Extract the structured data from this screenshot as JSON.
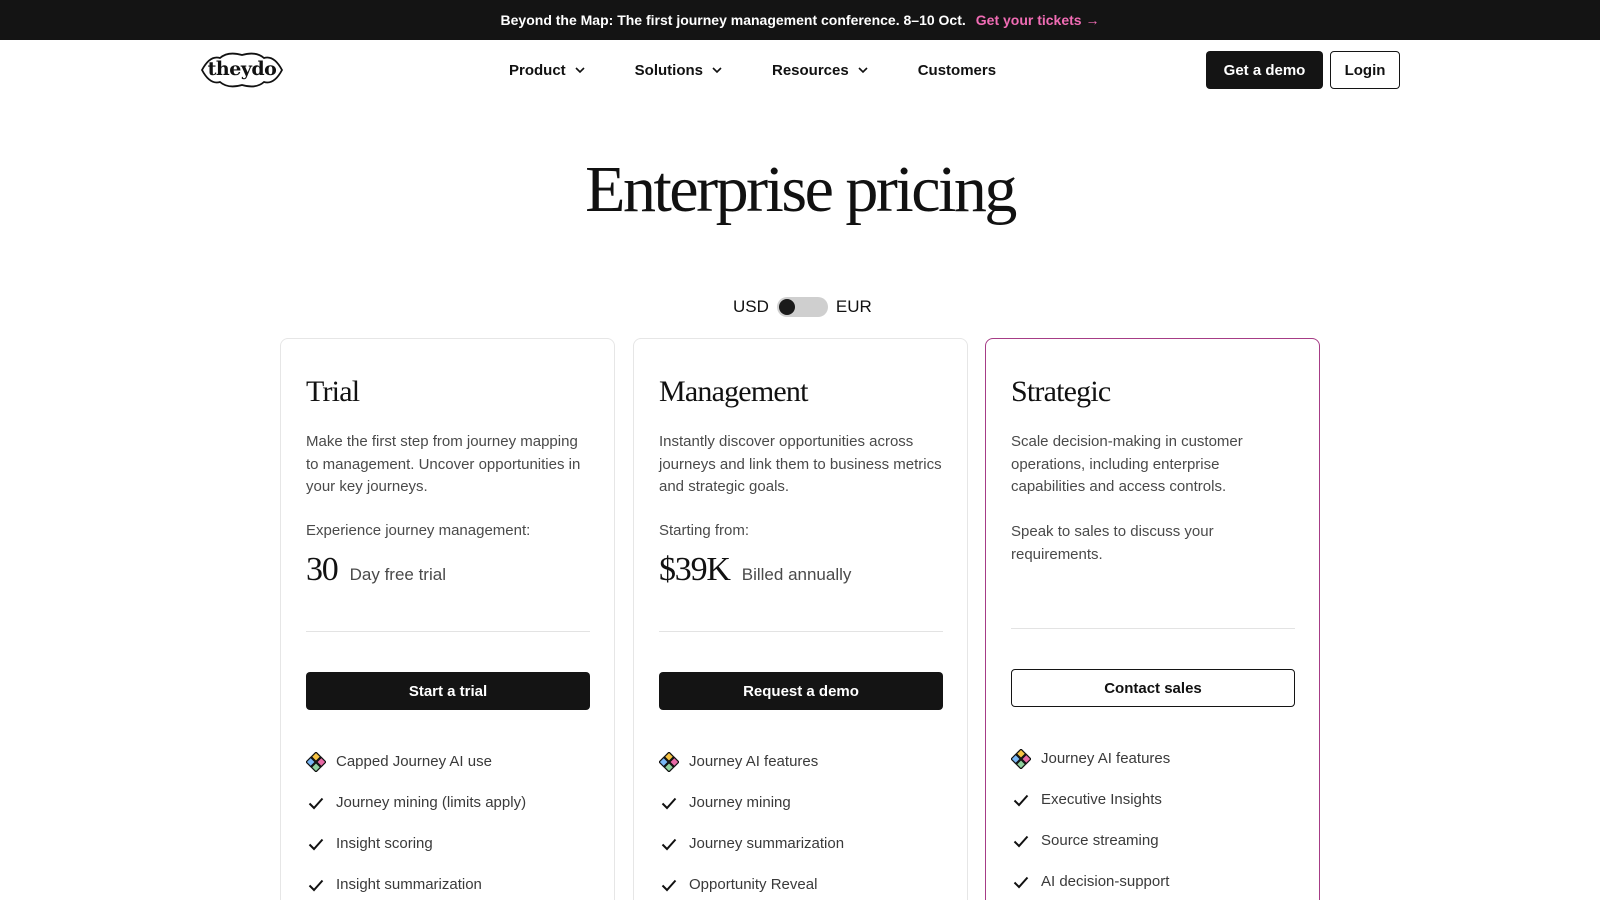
{
  "announcement": {
    "message": "Beyond the Map: The first journey management conference. 8–10 Oct.",
    "cta": "Get your tickets →"
  },
  "nav": {
    "logo_text": "theydo",
    "items": [
      {
        "label": "Product",
        "has_dropdown": true
      },
      {
        "label": "Solutions",
        "has_dropdown": true
      },
      {
        "label": "Resources",
        "has_dropdown": true
      },
      {
        "label": "Customers",
        "has_dropdown": false
      }
    ],
    "demo_button": "Get a demo",
    "login_button": "Login"
  },
  "hero": {
    "title": "Enterprise pricing"
  },
  "currency": {
    "left": "USD",
    "right": "EUR",
    "selected": "USD"
  },
  "plans": [
    {
      "name": "Trial",
      "description": "Make the first step from journey mapping to management. Uncover opportunities in your key journeys.",
      "pre_label": "Experience journey management:",
      "price": "30",
      "price_note": "Day free trial",
      "cta": "Start a trial",
      "features": [
        {
          "label": "Capped Journey AI use",
          "icon": "journey-ai-icon"
        },
        {
          "label": "Journey mining (limits apply)",
          "icon": "check-icon"
        },
        {
          "label": "Insight scoring",
          "icon": "check-icon"
        },
        {
          "label": "Insight summarization",
          "icon": "check-icon"
        }
      ]
    },
    {
      "name": "Management",
      "description": "Instantly discover opportunities across journeys and link them to  business metrics and strategic goals.",
      "pre_label": "Starting from:",
      "price": "$39K",
      "price_note": "Billed annually",
      "cta": "Request a demo",
      "features": [
        {
          "label": "Journey AI features",
          "icon": "journey-ai-icon"
        },
        {
          "label": "Journey mining",
          "icon": "check-icon"
        },
        {
          "label": "Journey summarization",
          "icon": "check-icon"
        },
        {
          "label": "Opportunity Reveal",
          "icon": "check-icon"
        }
      ]
    },
    {
      "name": "Strategic",
      "description": "Scale decision-making in customer operations, including enterprise capabilities and access controls.",
      "sales_note": "Speak to sales to discuss your requirements.",
      "cta": "Contact sales",
      "features": [
        {
          "label": "Journey AI features",
          "icon": "journey-ai-icon"
        },
        {
          "label": "Executive Insights",
          "icon": "check-icon"
        },
        {
          "label": "Source streaming",
          "icon": "check-icon"
        },
        {
          "label": "AI decision-support",
          "icon": "check-icon"
        }
      ]
    }
  ],
  "colors": {
    "dark": "#141414",
    "accent_pink": "#f06cb4",
    "featured_border": "#a63c86"
  }
}
